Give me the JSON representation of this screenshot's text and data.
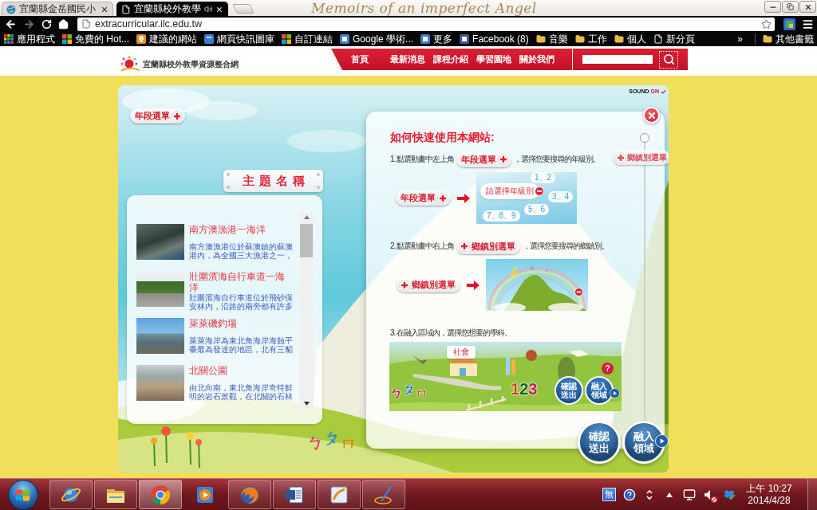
{
  "browser": {
    "tabs": [
      {
        "kind": "globe",
        "title": "宜蘭縣金岳國民小",
        "selected": false,
        "audio": false
      },
      {
        "kind": "page",
        "title": "宜蘭縣校外教學",
        "selected": true,
        "audio": true
      }
    ],
    "theme_caption": "Memoirs of an imperfect Angel",
    "forward_disabled": true,
    "url": "extracurricular.ilc.edu.tw",
    "bookmarks": [
      {
        "kind": "apps",
        "label": "應用程式"
      },
      {
        "kind": "windows",
        "label": "免費的 Hot..."
      },
      {
        "kind": "suggest",
        "label": "建議的網站"
      },
      {
        "kind": "gallery",
        "label": "網頁快訊圖庫"
      },
      {
        "kind": "windows",
        "label": "自訂連結"
      },
      {
        "kind": "scholar",
        "label": "Google 學術..."
      },
      {
        "kind": "google",
        "label": "更多"
      },
      {
        "kind": "facebook",
        "label": "Facebook (8)"
      },
      {
        "kind": "folder",
        "label": "音樂"
      },
      {
        "kind": "folder",
        "label": "工作"
      },
      {
        "kind": "folder",
        "label": "個人"
      },
      {
        "kind": "page",
        "label": "新分頁"
      }
    ],
    "bookmarks_overflow": "»",
    "other_bookmarks": "其他書籤"
  },
  "site": {
    "title": "宜蘭縣校外教學資源整合網",
    "nav": [
      "首頁",
      "最新消息",
      "課程介紹",
      "學習園地",
      "關於我們"
    ]
  },
  "scene": {
    "sound": {
      "label": "SOUND",
      "state": "ON"
    },
    "grade_menu": "年段選單",
    "town_menu": "鄉鎮別選單",
    "topic_sign": "主題名稱",
    "topics": [
      {
        "title": "南方澳漁港一海洋",
        "summary": "南方澳漁港位於蘇澳鎮的蘇澳港內，為全國三大漁港之一，"
      },
      {
        "title": "壯圍濱海自行車道一海洋",
        "summary": "壯圍濱海自行車道位於飛砂保安林內，沿路的兩旁都有許多"
      },
      {
        "title": "萊萊磯釣場",
        "summary": "萊萊海岸為東北角海岸海蝕平臺最為發達的地區，北有三貂"
      },
      {
        "title": "北關公園",
        "summary": "由北向南，東北角海岸奇特鮮明的岩石景觀，在北關的石林"
      }
    ],
    "letters": "ㄅㄆㄇ",
    "confirm_button": "確認送出",
    "field_button": "融入領域"
  },
  "help": {
    "title": "如何快速使用本網站:",
    "steps": [
      {
        "kind": "grade",
        "text": "1. 點選動畫中左上角",
        "button": "年段選單",
        "text_after": "，選擇您要搜尋的年級別。",
        "demo_button": "年段選單",
        "demo": {
          "prompt": "請選擇年級別",
          "options": [
            "1、2",
            "3、4",
            "5、6",
            "7、8、9"
          ]
        }
      },
      {
        "kind": "town",
        "text": "2. 點選動畫中右上角",
        "button": "鄉鎮別選單",
        "text_after": "，選擇您要搜尋的鄉鎮別。",
        "demo_button": "鄉鎮別選單"
      },
      {
        "kind": "subject",
        "text": "3. 在融入區域內，選擇您想要的學科。",
        "demo": {
          "tag": "社會",
          "letters": "ㄅㄆㄇ",
          "numbers": "123",
          "confirm": "確認送出",
          "field": "融入領域",
          "help": "?"
        }
      }
    ]
  },
  "taskbar": {
    "apps": [
      {
        "kind": "ie",
        "running": true,
        "active": false
      },
      {
        "kind": "explorer",
        "running": true,
        "active": false
      },
      {
        "kind": "chrome",
        "running": true,
        "active": true
      },
      {
        "kind": "media",
        "running": false,
        "active": false
      },
      {
        "kind": "firefox",
        "running": true,
        "active": false
      },
      {
        "kind": "word",
        "running": true,
        "active": false
      },
      {
        "kind": "sketch",
        "running": true,
        "active": false
      },
      {
        "kind": "pen",
        "running": true,
        "active": false
      }
    ],
    "tray": {
      "ime": "無",
      "volume_muted": true,
      "time": "上午 10:27",
      "date": "2014/4/28"
    }
  }
}
